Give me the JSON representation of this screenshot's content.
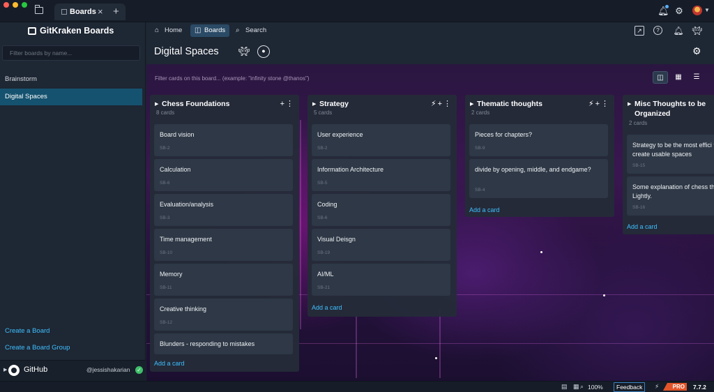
{
  "titlebar": {
    "tab_label": "Boards",
    "tab_close": "×",
    "tab_add": "+"
  },
  "sidebar": {
    "logo": "GitKraken Boards",
    "filter_placeholder": "Filter boards by name...",
    "boards": [
      {
        "label": "Brainstorm",
        "active": false
      },
      {
        "label": "Digital Spaces",
        "active": true
      }
    ],
    "create_board": "Create a Board",
    "create_board_group": "Create a Board Group",
    "github": {
      "label": "GitHub",
      "username": "@jessishakarian"
    }
  },
  "topnav": {
    "home": "Home",
    "boards": "Boards",
    "search": "Search"
  },
  "board": {
    "title": "Digital Spaces",
    "filter_placeholder": "Filter cards on this board... (example: \"infinity stone @thanos\")",
    "add_card_label": "Add a card",
    "columns": [
      {
        "title": "Chess Foundations",
        "count": "8 cards",
        "cards": [
          {
            "title": "Board vision",
            "id": "SB-2"
          },
          {
            "title": "Calculation",
            "id": "SB-6"
          },
          {
            "title": "Evaluation/analysis",
            "id": "SB-3"
          },
          {
            "title": "Time management",
            "id": "SB-10"
          },
          {
            "title": "Memory",
            "id": "SB-11"
          },
          {
            "title": "Creative thinking",
            "id": "SB-12"
          },
          {
            "title": "Blunders - responding to mistakes",
            "id": ""
          }
        ]
      },
      {
        "title": "Strategy",
        "count": "5 cards",
        "cards": [
          {
            "title": "User experience",
            "id": "SB-2"
          },
          {
            "title": "Information Architecture",
            "id": "SB-5"
          },
          {
            "title": "Coding",
            "id": "SB-6"
          },
          {
            "title": "Visual Deisgn",
            "id": "SB-19"
          },
          {
            "title": "AI/ML",
            "id": "SB-21"
          }
        ]
      },
      {
        "title": "Thematic thoughts",
        "count": "2 cards",
        "cards": [
          {
            "title": "Pieces for chapters?",
            "id": "SB-9"
          },
          {
            "title": "divide by opening, middle, and endgame?",
            "id": "SB-4"
          }
        ]
      },
      {
        "title": "Misc Thoughts to be Organized",
        "count": "2 cards",
        "cards": [
          {
            "title": "Strategy to be the most effici to create usable spaces",
            "id": "SB-15"
          },
          {
            "title": "Some explanation of chess th Lightly.",
            "id": "SB-16"
          }
        ]
      }
    ]
  },
  "statusbar": {
    "zoom": "100%",
    "feedback": "Feedback",
    "pro": "PRO",
    "version": "7.7.2"
  },
  "colors": {
    "accent_link": "#3ec0ff",
    "active_board": "#15526f",
    "pro_badge": "#e2552a"
  }
}
